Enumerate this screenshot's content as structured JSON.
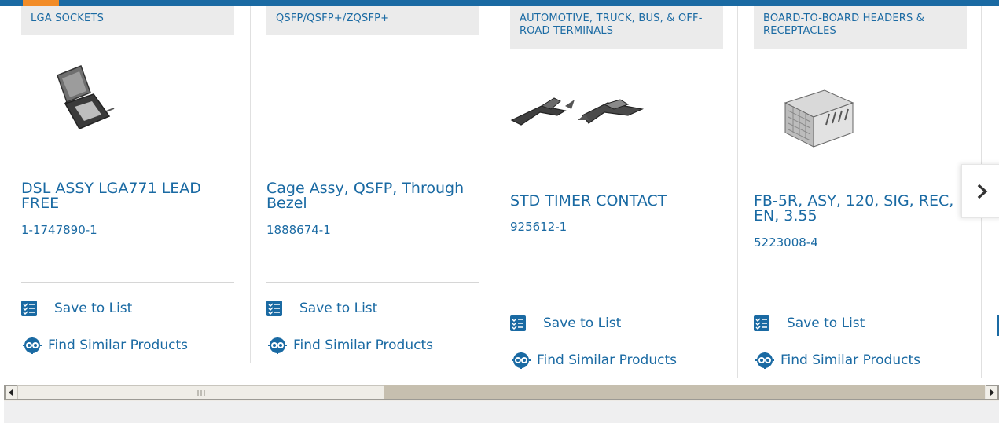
{
  "accent_color": "#1a6aa3",
  "cards": [
    {
      "category": "LGA SOCKETS",
      "image_icon": "lga-socket-image",
      "title": "DSL ASSY LGA771 LEAD FREE",
      "part_number": "1-1747890-1",
      "save_label": "Save to List",
      "similar_label": "Find Similar Products"
    },
    {
      "category": "QSFP/QSFP+/ZQSFP+",
      "image_icon": "",
      "title": "Cage Assy, QSFP, Through Bezel",
      "part_number": "1888674-1",
      "save_label": "Save to List",
      "similar_label": "Find Similar Products"
    },
    {
      "category": "AUTOMOTIVE, TRUCK, BUS, & OFF-ROAD TERMINALS",
      "image_icon": "terminal-contact-image",
      "title": "STD TIMER CONTACT",
      "part_number": "925612-1",
      "save_label": "Save to List",
      "similar_label": "Find Similar Products"
    },
    {
      "category": "BOARD-TO-BOARD HEADERS & RECEPTACLES",
      "image_icon": "board-connector-image",
      "title": "FB-5R, ASY, 120, SIG, REC, EN, 3.55",
      "part_number": "5223008-4",
      "save_label": "Save to List",
      "similar_label": "Find Similar Products"
    }
  ],
  "carousel": {
    "next_icon": "chevron-right-icon"
  },
  "scrollbar": {
    "left_arrow": "arrow-left-icon",
    "right_arrow": "arrow-right-icon"
  }
}
